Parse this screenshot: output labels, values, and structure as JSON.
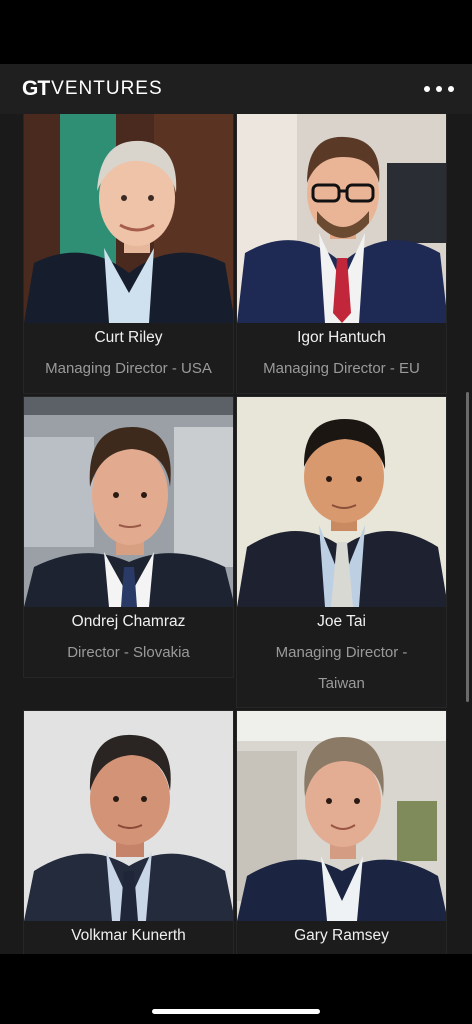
{
  "header": {
    "logo_mark": "GT",
    "logo_word": "VENTURES",
    "menu_icon": "more-dots-icon"
  },
  "team": [
    {
      "name": "Curt Riley",
      "role": "Managing Director - USA"
    },
    {
      "name": "Igor Hantuch",
      "role": "Managing Director - EU"
    },
    {
      "name": "Ondrej Chamraz",
      "role": "Director - Slovakia"
    },
    {
      "name": "Joe Tai",
      "role": "Managing Director - Taiwan",
      "role_line1": "Managing Director -",
      "role_line2": "Taiwan"
    },
    {
      "name": "Volkmar Kunerth"
    },
    {
      "name": "Gary Ramsey"
    }
  ],
  "colors": {
    "background": "#1a1a1a",
    "header": "#1f1f1f",
    "brand_red": "#d0202b",
    "role_text": "#9a9a9a"
  }
}
